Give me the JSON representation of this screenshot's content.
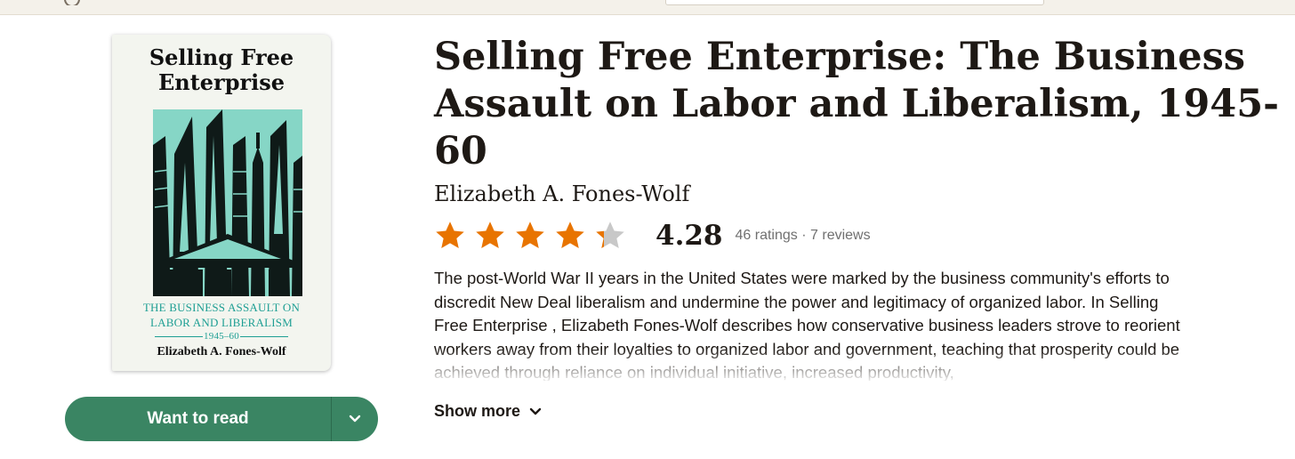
{
  "cover": {
    "title_line1": "Selling Free",
    "title_line2": "Enterprise",
    "subtitle_line1": "THE BUSINESS ASSAULT ON",
    "subtitle_line2": "LABOR AND LIBERALISM",
    "years": "1945–60",
    "author": "Elizabeth A. Fones-Wolf"
  },
  "book": {
    "title": "Selling Free Enterprise: The Business Assault on Labor and Liberalism, 1945-60",
    "author": "Elizabeth A. Fones-Wolf"
  },
  "rating": {
    "value": "4.28",
    "stars_filled": 4.28,
    "ratings_count": "46 ratings",
    "separator": "·",
    "reviews_count": "7 reviews"
  },
  "description": "The post-World War II years in the United States were marked by the business community's efforts to discredit New Deal liberalism and undermine the power and legitimacy of organized labor. In Selling Free Enterprise , Elizabeth Fones-Wolf describes how conservative business leaders strove to reorient workers away from their loyalties to organized labor and government, teaching that prosperity could be achieved through reliance on individual initiative, increased productivity,",
  "actions": {
    "want_to_read_label": "Want to read",
    "show_more_label": "Show more"
  },
  "icons": {
    "dropdown": "chevron-down-icon",
    "show_more": "chevron-down-icon",
    "star": "star-icon"
  },
  "colors": {
    "button": "#3a8563",
    "star_filled": "#e87400",
    "star_empty": "#c8c8c8",
    "topbar": "#f4f1ea"
  }
}
